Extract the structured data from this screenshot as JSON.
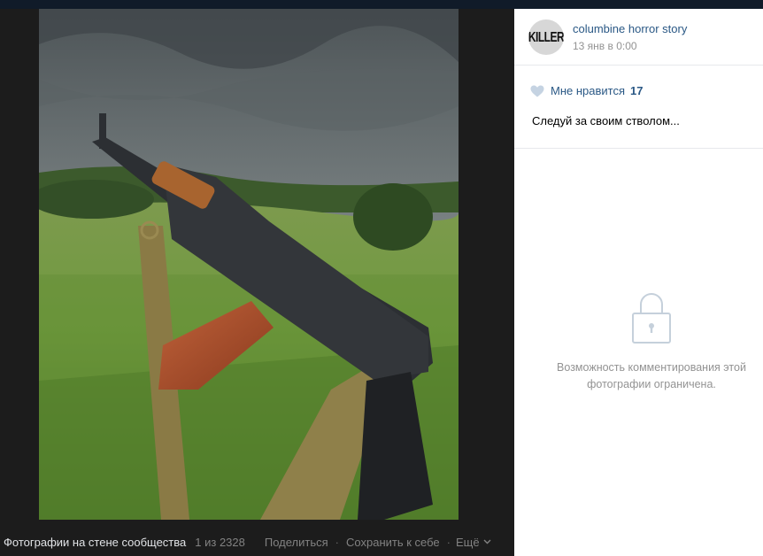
{
  "footer": {
    "album": "Фотографии на стене сообщества",
    "counter": "1 из 2328",
    "share": "Поделиться",
    "save": "Сохранить к себе",
    "more": "Ещё"
  },
  "post": {
    "avatar_text": "KILLER",
    "author": "columbine horror story",
    "date": "13 янв в 0:00",
    "like_label": "Мне нравится",
    "like_count": "17",
    "caption": "Следуй за своим стволом...",
    "comments_restricted": "Возможность комментирования этой фотографии ограничена."
  },
  "icons": {
    "like": "heart-icon",
    "lock": "lock-icon",
    "more": "chevron-down-icon"
  },
  "colors": {
    "link": "#2a5885",
    "muted": "#939393",
    "viewer_bg": "#1c1c1c"
  }
}
